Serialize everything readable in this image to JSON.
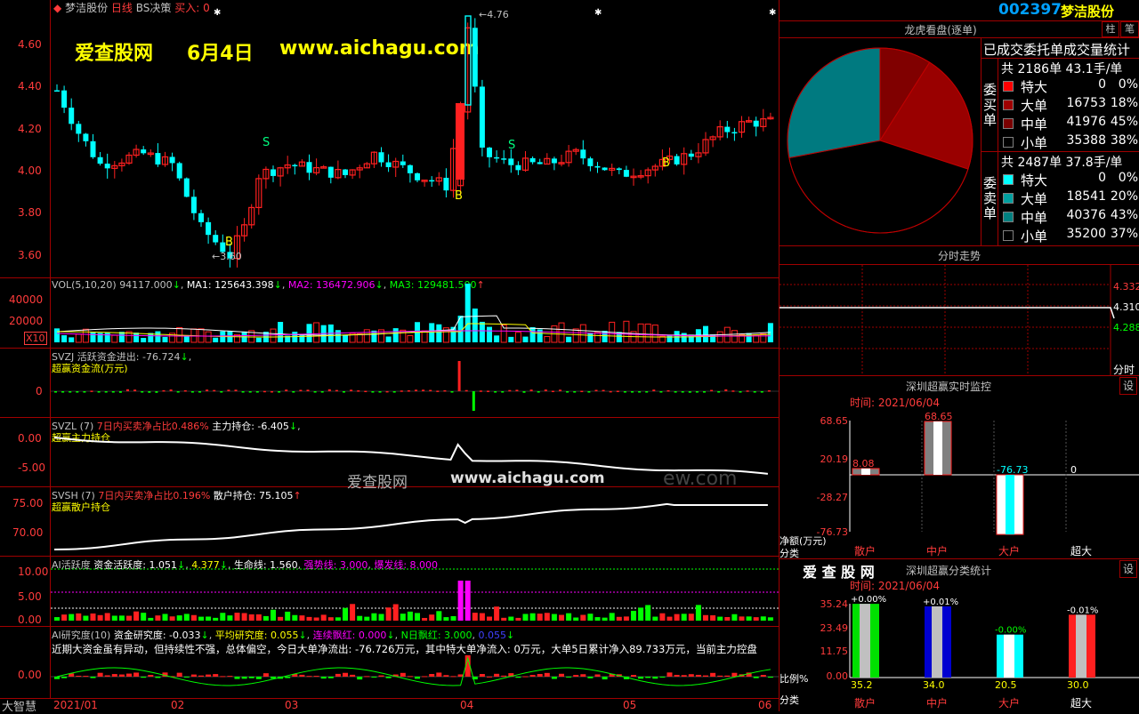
{
  "header": {
    "stock_name": "梦洁股份",
    "period": "日线",
    "strategy": "BS决策",
    "buy_label": "买入: 0",
    "code": "002397",
    "code_name": "梦洁股份",
    "btn_zhu": "柱",
    "btn_bi": "笔"
  },
  "watermark": {
    "site_cn": "爱查股网",
    "date": "6月4日",
    "url": "www.aichagu.com",
    "center_cn": "爱查股网",
    "center_url": "www.aichagu.com",
    "faint_tail": "ew.com"
  },
  "price_axis": [
    "4.60",
    "4.40",
    "4.20",
    "4.00",
    "3.80",
    "3.60"
  ],
  "price_marks": {
    "high": "4.76",
    "low": "3.60"
  },
  "signals": {
    "s": "S",
    "b": "B"
  },
  "vol_panel": {
    "title": "VOL(5,10,20)",
    "vol": "94117.000",
    "ma1": "MA1: 125643.398",
    "ma2": "MA2: 136472.906",
    "ma3": "MA3: 129481.500",
    "axis": [
      "40000",
      "20000"
    ],
    "unit": "X10"
  },
  "svzj_panel": {
    "title": "SVZJ",
    "line1": "活跃资金进出: -76.724",
    "line2": "超赢资金流(万元)",
    "axis": [
      "0"
    ]
  },
  "svzl_panel": {
    "title": "SVZL (7)",
    "l1": "7日内买卖净占比0.486%",
    "l2": "主力持仓: -6.405",
    "l3": "超赢主力持仓",
    "axis": [
      "0.00",
      "-5.00"
    ]
  },
  "svsh_panel": {
    "title": "SVSH (7)",
    "l1": "7日内买卖净占比0.196%",
    "l2": "散户持仓: 75.105",
    "l3": "超赢散户持仓",
    "axis": [
      "75.00",
      "70.00"
    ]
  },
  "ai_panel": {
    "title": "AI活跃度",
    "l1": "资金活跃度: 1.051",
    "l2": "4.377",
    "l3": "生命线: 1.560",
    "l4": "强势线: 3.000",
    "l5": "爆发线: 8.000",
    "axis": [
      "10.00",
      "5.00",
      "0.00"
    ]
  },
  "research_panel": {
    "title": "AI研究度(10)",
    "l1": "资金研究度: -0.033",
    "l2": "平均研究度: 0.055",
    "l3": "连续飘红: 0.000",
    "l4": "N日飘红: 3.000",
    "l5": "0.055",
    "text": "近期大资金虽有异动，但持续性不强，总体偏空，今日大单净流出: -76.726万元，其中特大单净流入: 0万元，大单5日累计净入89.733万元，当前主力控盘",
    "axis": [
      "0.00"
    ],
    "corner": "大智慧"
  },
  "date_axis": [
    "2021/01",
    "02",
    "03",
    "04",
    "05",
    "06"
  ],
  "dragon": {
    "title": "龙虎看盘(逐单)",
    "stats_title": "已成交委托单成交量统计",
    "buy_vert": "委买单",
    "sell_vert": "委卖单",
    "buy_total": "共 2186单 43.1手/单",
    "sell_total": "共 2487单 37.8手/单",
    "buy_rows": [
      {
        "label": "特大",
        "val": "0",
        "pct": "0%",
        "color": "#ff0000"
      },
      {
        "label": "大单",
        "val": "16753",
        "pct": "18%",
        "color": "#a00000"
      },
      {
        "label": "中单",
        "val": "41976",
        "pct": "45%",
        "color": "#7a0000"
      },
      {
        "label": "小单",
        "val": "35388",
        "pct": "38%",
        "color": "#000000"
      }
    ],
    "sell_rows": [
      {
        "label": "特大",
        "val": "0",
        "pct": "0%",
        "color": "#00ffff"
      },
      {
        "label": "大单",
        "val": "18541",
        "pct": "20%",
        "color": "#00a0a0"
      },
      {
        "label": "中单",
        "val": "40376",
        "pct": "43%",
        "color": "#008080"
      },
      {
        "label": "小单",
        "val": "35200",
        "pct": "37%",
        "color": "#000000"
      }
    ]
  },
  "intraday": {
    "title": "分时走势",
    "axis": [
      "4.332",
      "4.310",
      "4.288"
    ],
    "corner": "分时"
  },
  "monitor": {
    "title": "深圳超赢实时监控",
    "settings": "设",
    "time": "时间: 2021/06/04",
    "axis": [
      "68.65",
      "20.19",
      "-28.27",
      "-76.73"
    ],
    "vals": [
      "8.08",
      "68.65",
      "-76.73",
      "0"
    ],
    "cats": [
      "散户",
      "中户",
      "大户",
      "超大"
    ],
    "ylab": "净额(万元)",
    "xlab": "分类"
  },
  "classify": {
    "brand": "爱 查 股 网",
    "title": "深圳超赢分类统计",
    "settings": "设",
    "time": "时间: 2021/06/04",
    "axis": [
      "35.24",
      "23.49",
      "11.75",
      "0.00"
    ],
    "tops": [
      "+0.00%",
      "+0.01%",
      "-0.00%",
      "-0.01%"
    ],
    "bottoms": [
      "35.2",
      "34.0",
      "20.5",
      "30.0"
    ],
    "cats": [
      "散户",
      "中户",
      "大户",
      "超大"
    ],
    "ylab": "比例%",
    "xlab": "分类"
  }
}
